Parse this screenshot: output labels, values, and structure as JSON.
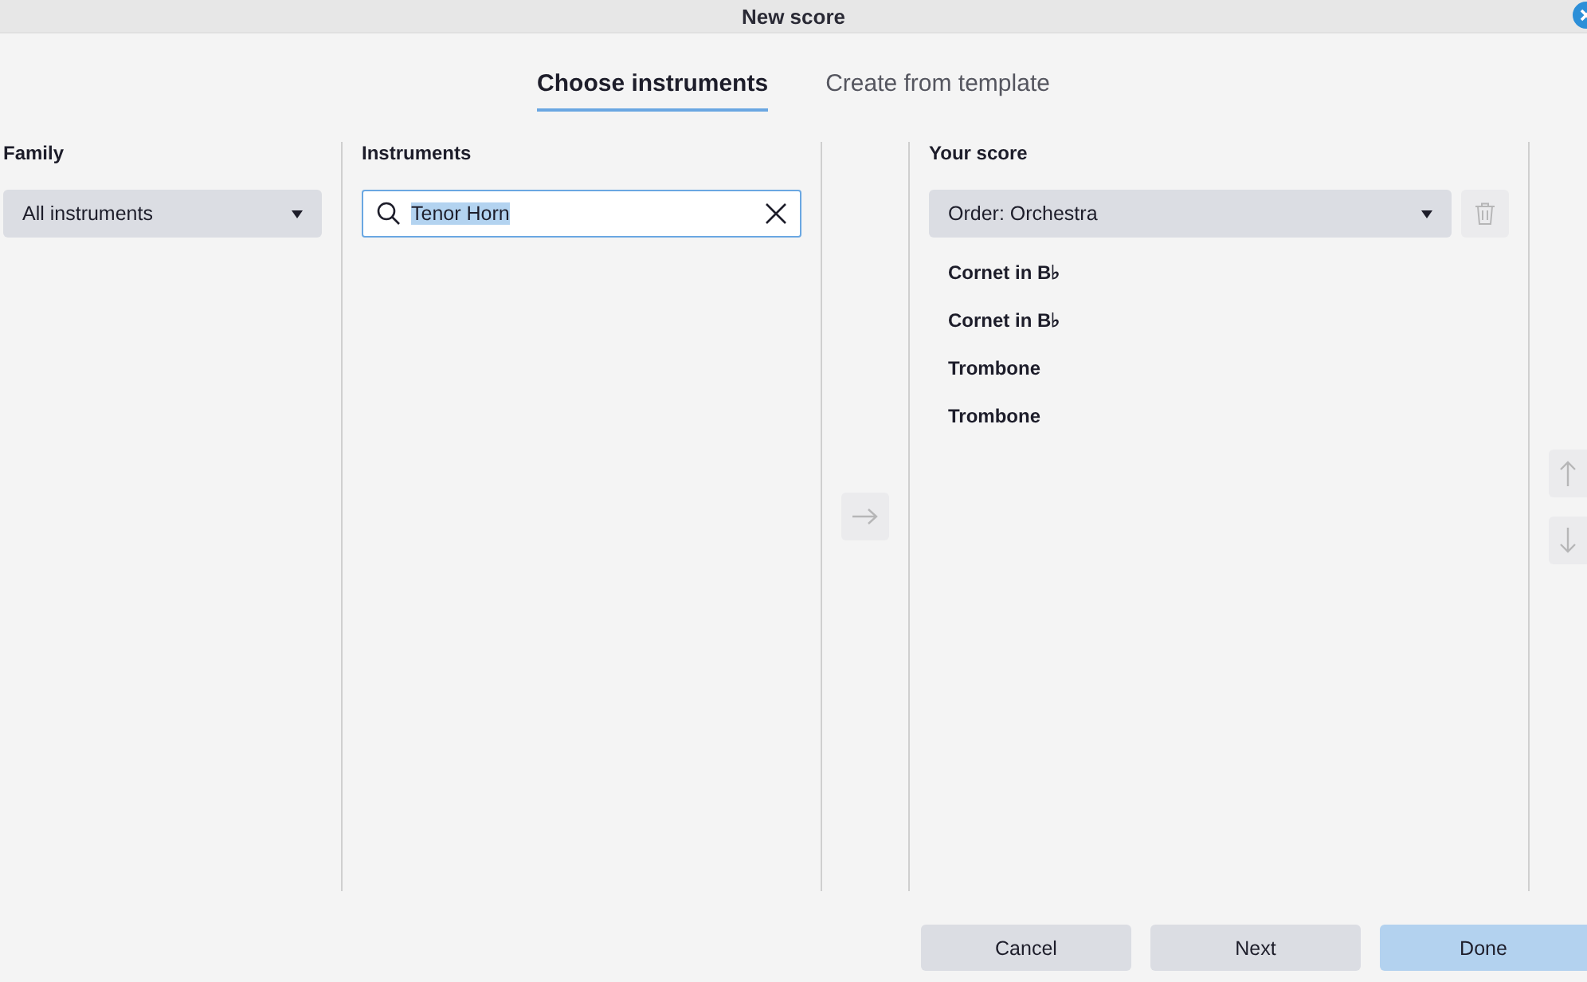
{
  "window": {
    "title": "New score"
  },
  "tabs": [
    {
      "label": "Choose instruments",
      "selected": true
    },
    {
      "label": "Create from template",
      "selected": false
    }
  ],
  "family": {
    "heading": "Family",
    "dropdown": "All instruments"
  },
  "instruments": {
    "heading": "Instruments",
    "search": {
      "value": "Tenor Horn",
      "text_selected": true
    }
  },
  "add_button": {
    "disabled": true
  },
  "your_score": {
    "heading": "Your score",
    "order_dropdown": "Order: Orchestra",
    "delete_disabled": true,
    "items": [
      {
        "label": "Cornet in B♭"
      },
      {
        "label": "Cornet in B♭"
      },
      {
        "label": "Trombone"
      },
      {
        "label": "Trombone"
      }
    ]
  },
  "move_buttons": [
    {
      "kind": "up",
      "disabled": true
    },
    {
      "kind": "down",
      "disabled": true
    }
  ],
  "buttons": [
    {
      "label": "Cancel",
      "kind": "normal"
    },
    {
      "label": "Next",
      "kind": "normal"
    },
    {
      "label": "Done",
      "kind": "accent"
    }
  ]
}
